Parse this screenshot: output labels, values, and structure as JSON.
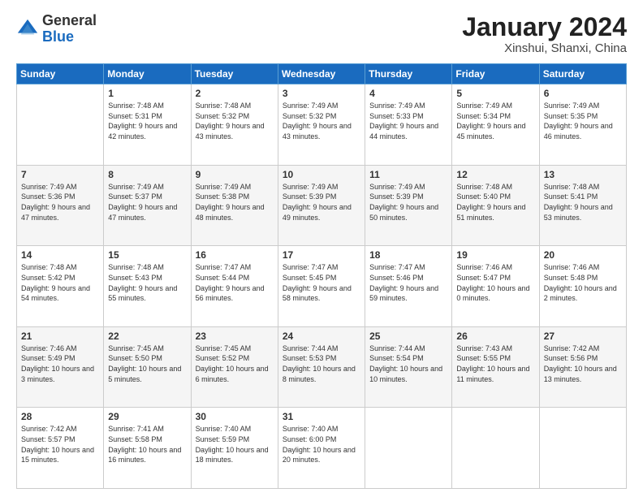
{
  "logo": {
    "general": "General",
    "blue": "Blue"
  },
  "header": {
    "month": "January 2024",
    "location": "Xinshui, Shanxi, China"
  },
  "weekdays": [
    "Sunday",
    "Monday",
    "Tuesday",
    "Wednesday",
    "Thursday",
    "Friday",
    "Saturday"
  ],
  "weeks": [
    [
      {
        "day": "",
        "sunrise": "",
        "sunset": "",
        "daylight": ""
      },
      {
        "day": "1",
        "sunrise": "Sunrise: 7:48 AM",
        "sunset": "Sunset: 5:31 PM",
        "daylight": "Daylight: 9 hours and 42 minutes."
      },
      {
        "day": "2",
        "sunrise": "Sunrise: 7:48 AM",
        "sunset": "Sunset: 5:32 PM",
        "daylight": "Daylight: 9 hours and 43 minutes."
      },
      {
        "day": "3",
        "sunrise": "Sunrise: 7:49 AM",
        "sunset": "Sunset: 5:32 PM",
        "daylight": "Daylight: 9 hours and 43 minutes."
      },
      {
        "day": "4",
        "sunrise": "Sunrise: 7:49 AM",
        "sunset": "Sunset: 5:33 PM",
        "daylight": "Daylight: 9 hours and 44 minutes."
      },
      {
        "day": "5",
        "sunrise": "Sunrise: 7:49 AM",
        "sunset": "Sunset: 5:34 PM",
        "daylight": "Daylight: 9 hours and 45 minutes."
      },
      {
        "day": "6",
        "sunrise": "Sunrise: 7:49 AM",
        "sunset": "Sunset: 5:35 PM",
        "daylight": "Daylight: 9 hours and 46 minutes."
      }
    ],
    [
      {
        "day": "7",
        "sunrise": "Sunrise: 7:49 AM",
        "sunset": "Sunset: 5:36 PM",
        "daylight": "Daylight: 9 hours and 47 minutes."
      },
      {
        "day": "8",
        "sunrise": "Sunrise: 7:49 AM",
        "sunset": "Sunset: 5:37 PM",
        "daylight": "Daylight: 9 hours and 47 minutes."
      },
      {
        "day": "9",
        "sunrise": "Sunrise: 7:49 AM",
        "sunset": "Sunset: 5:38 PM",
        "daylight": "Daylight: 9 hours and 48 minutes."
      },
      {
        "day": "10",
        "sunrise": "Sunrise: 7:49 AM",
        "sunset": "Sunset: 5:39 PM",
        "daylight": "Daylight: 9 hours and 49 minutes."
      },
      {
        "day": "11",
        "sunrise": "Sunrise: 7:49 AM",
        "sunset": "Sunset: 5:39 PM",
        "daylight": "Daylight: 9 hours and 50 minutes."
      },
      {
        "day": "12",
        "sunrise": "Sunrise: 7:48 AM",
        "sunset": "Sunset: 5:40 PM",
        "daylight": "Daylight: 9 hours and 51 minutes."
      },
      {
        "day": "13",
        "sunrise": "Sunrise: 7:48 AM",
        "sunset": "Sunset: 5:41 PM",
        "daylight": "Daylight: 9 hours and 53 minutes."
      }
    ],
    [
      {
        "day": "14",
        "sunrise": "Sunrise: 7:48 AM",
        "sunset": "Sunset: 5:42 PM",
        "daylight": "Daylight: 9 hours and 54 minutes."
      },
      {
        "day": "15",
        "sunrise": "Sunrise: 7:48 AM",
        "sunset": "Sunset: 5:43 PM",
        "daylight": "Daylight: 9 hours and 55 minutes."
      },
      {
        "day": "16",
        "sunrise": "Sunrise: 7:47 AM",
        "sunset": "Sunset: 5:44 PM",
        "daylight": "Daylight: 9 hours and 56 minutes."
      },
      {
        "day": "17",
        "sunrise": "Sunrise: 7:47 AM",
        "sunset": "Sunset: 5:45 PM",
        "daylight": "Daylight: 9 hours and 58 minutes."
      },
      {
        "day": "18",
        "sunrise": "Sunrise: 7:47 AM",
        "sunset": "Sunset: 5:46 PM",
        "daylight": "Daylight: 9 hours and 59 minutes."
      },
      {
        "day": "19",
        "sunrise": "Sunrise: 7:46 AM",
        "sunset": "Sunset: 5:47 PM",
        "daylight": "Daylight: 10 hours and 0 minutes."
      },
      {
        "day": "20",
        "sunrise": "Sunrise: 7:46 AM",
        "sunset": "Sunset: 5:48 PM",
        "daylight": "Daylight: 10 hours and 2 minutes."
      }
    ],
    [
      {
        "day": "21",
        "sunrise": "Sunrise: 7:46 AM",
        "sunset": "Sunset: 5:49 PM",
        "daylight": "Daylight: 10 hours and 3 minutes."
      },
      {
        "day": "22",
        "sunrise": "Sunrise: 7:45 AM",
        "sunset": "Sunset: 5:50 PM",
        "daylight": "Daylight: 10 hours and 5 minutes."
      },
      {
        "day": "23",
        "sunrise": "Sunrise: 7:45 AM",
        "sunset": "Sunset: 5:52 PM",
        "daylight": "Daylight: 10 hours and 6 minutes."
      },
      {
        "day": "24",
        "sunrise": "Sunrise: 7:44 AM",
        "sunset": "Sunset: 5:53 PM",
        "daylight": "Daylight: 10 hours and 8 minutes."
      },
      {
        "day": "25",
        "sunrise": "Sunrise: 7:44 AM",
        "sunset": "Sunset: 5:54 PM",
        "daylight": "Daylight: 10 hours and 10 minutes."
      },
      {
        "day": "26",
        "sunrise": "Sunrise: 7:43 AM",
        "sunset": "Sunset: 5:55 PM",
        "daylight": "Daylight: 10 hours and 11 minutes."
      },
      {
        "day": "27",
        "sunrise": "Sunrise: 7:42 AM",
        "sunset": "Sunset: 5:56 PM",
        "daylight": "Daylight: 10 hours and 13 minutes."
      }
    ],
    [
      {
        "day": "28",
        "sunrise": "Sunrise: 7:42 AM",
        "sunset": "Sunset: 5:57 PM",
        "daylight": "Daylight: 10 hours and 15 minutes."
      },
      {
        "day": "29",
        "sunrise": "Sunrise: 7:41 AM",
        "sunset": "Sunset: 5:58 PM",
        "daylight": "Daylight: 10 hours and 16 minutes."
      },
      {
        "day": "30",
        "sunrise": "Sunrise: 7:40 AM",
        "sunset": "Sunset: 5:59 PM",
        "daylight": "Daylight: 10 hours and 18 minutes."
      },
      {
        "day": "31",
        "sunrise": "Sunrise: 7:40 AM",
        "sunset": "Sunset: 6:00 PM",
        "daylight": "Daylight: 10 hours and 20 minutes."
      },
      {
        "day": "",
        "sunrise": "",
        "sunset": "",
        "daylight": ""
      },
      {
        "day": "",
        "sunrise": "",
        "sunset": "",
        "daylight": ""
      },
      {
        "day": "",
        "sunrise": "",
        "sunset": "",
        "daylight": ""
      }
    ]
  ]
}
